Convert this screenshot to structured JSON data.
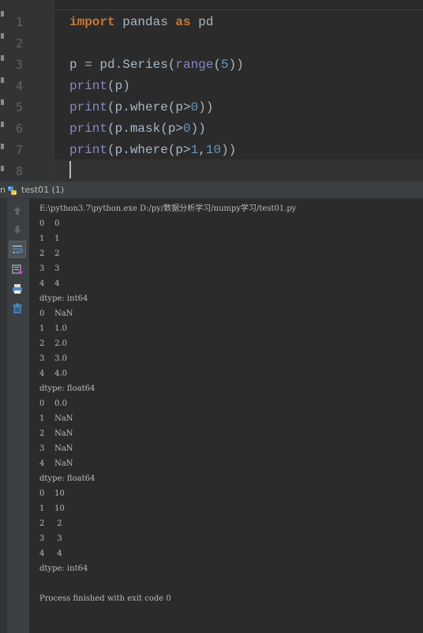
{
  "editor": {
    "line_numbers": [
      "1",
      "2",
      "3",
      "4",
      "5",
      "6",
      "7",
      "8"
    ],
    "code": {
      "l1_kw_import": "import",
      "l1_mod": " pandas ",
      "l1_kw_as": "as",
      "l1_alias": " pd",
      "l3_pre": "p = pd.Series(",
      "l3_range": "range",
      "l3_open": "(",
      "l3_num": "5",
      "l3_close": "))",
      "l4_print": "print",
      "l4_rest": "(p)",
      "l5_print": "print",
      "l5_rest_a": "(p.where(p>",
      "l5_num": "0",
      "l5_rest_b": "))",
      "l6_print": "print",
      "l6_rest_a": "(p.mask(p>",
      "l6_num": "0",
      "l6_rest_b": "))",
      "l7_print": "print",
      "l7_rest_a": "(p.where(p>",
      "l7_num1": "1",
      "l7_comma": ",",
      "l7_num2": "10",
      "l7_rest_b": "))"
    }
  },
  "run_panel": {
    "prefix": "n",
    "tab_label": "test01 (1)",
    "tools": [
      "up-arrow-icon",
      "down-arrow-icon",
      "soft-wrap-icon",
      "scroll-to-end-icon",
      "print-icon",
      "trash-icon"
    ]
  },
  "console": {
    "lines": [
      "E:\\python3.7\\python.exe D:/py/数据分析学习/numpy学习/test01.py",
      "0    0",
      "1    1",
      "2    2",
      "3    3",
      "4    4",
      "dtype: int64",
      "0    NaN",
      "1    1.0",
      "2    2.0",
      "3    3.0",
      "4    4.0",
      "dtype: float64",
      "0    0.0",
      "1    NaN",
      "2    NaN",
      "3    NaN",
      "4    NaN",
      "dtype: float64",
      "0    10",
      "1    10",
      "2     2",
      "3     3",
      "4     4",
      "dtype: int64",
      "",
      "Process finished with exit code 0"
    ]
  },
  "colors": {
    "background": "#2b2b2b",
    "keyword": "#cc7832",
    "builtin": "#8888c6",
    "number": "#6897bb",
    "text": "#a9b7c6"
  }
}
